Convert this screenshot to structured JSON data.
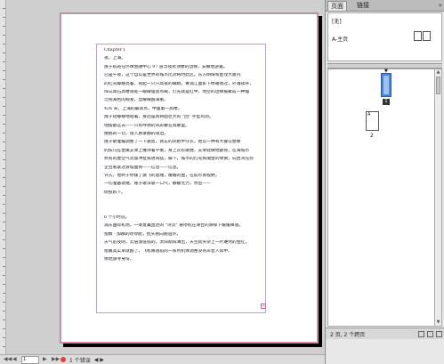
{
  "document": {
    "lines": [
      "Chapter 1",
      "夜，上海。",
      "隆子航班在环球金融中心 97 层浮夜式顶楼的边缘，安静地游着。",
      "已是午夜，这个自以是世界的城市比对将时此区。东方明珠和金茂大厦内",
      "的红光静静亮着，晃起一只只高夜的眼睛，黄浦江面影下桥箱而过，外滩夜序，",
      "阵试尚石高楼观处一眼眼强亮点眼，灯光就是红中，而空的边缘被聚成一种插",
      "泛视海色的规发，显耀眼越海重。",
      "426 米，上海的最高点，中国第一高楼。",
      "隆子轻静静地站着，身后是真将面巨大的 \"回\" 字型风洞。",
      "他摆都这去——只有呼啸的风声撒在耳廓里。",
      "抿抿的一切，隐入质掌翻的夜边。",
      "隆子歌准编调整了一下姿势，真实的风把牛仔衣，他以一种有大睿以想象",
      "的技巧在金属支架上维持着平衡，身上衣衫歌捷，支架轻微地颤晃，在海城市",
      "熟有的虚空气流量冲扯排进耳弦，脚下，城市的灯光如潮金的倾倒，向西湾充弥",
      "企且看紧过渡城面将——信息——信息。",
      "许久，他终于你拔了飘飞的思绪，缓缓的盘，在前珍南视野。",
      "一切准备就绪，隆子歌深吸一口气，静静无力，然后——",
      "俯投跃下。",
      "",
      "",
      "6 个小时前。",
      "浦东国际机场，一架夏翼直达的 \"湾流\" 悬停机在滑台的滑痒下缓缓降落。",
      "指数 · 加群的吹停舱，抚头看向跑道外。",
      "天气前夜阴，云层落低低的，太阳刚阵薄出，天空就夹杂上一片难然的金红，",
      "指属其实早就醒了，飞机降落前的一系列机体调整没有声音入耳中。",
      "依地旗寻身份。"
    ],
    "overset_marker": "+"
  },
  "statusbar": {
    "zoom_prefix": "",
    "page_field": "1",
    "nav_first": "◀◀",
    "nav_prev": "◀",
    "nav_next": "▶",
    "nav_last": "▶▶",
    "error_text": "1 个错误",
    "extra": "◀ ▶"
  },
  "panel": {
    "tab_pages": "页面",
    "tab_links": "链接",
    "menu_glyph": "»",
    "masters": {
      "none_label": "[无]",
      "a_master_label": "A-主页"
    },
    "page1_badge": "1",
    "page2_letter": "A",
    "page2_label": "2",
    "status_text": "2 页, 2 个跨页"
  },
  "colors": {
    "accent": "#4b86d6",
    "bleed": "#e58bb0",
    "margin": "#b9a0d6",
    "error": "#dd4433"
  }
}
